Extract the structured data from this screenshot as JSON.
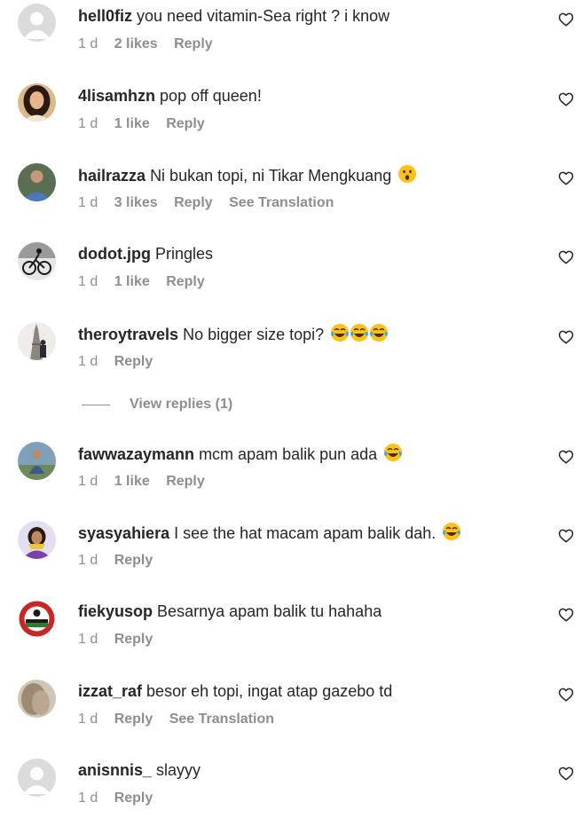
{
  "comments": [
    {
      "username": "hell0fiz",
      "text": "you need vitamin-Sea right ? i know",
      "time": "1 d",
      "likes": "2 likes",
      "reply": "Reply",
      "avatar": "default-avatar-icon"
    },
    {
      "username": "4lisamhzn",
      "text": "pop off queen!",
      "time": "1 d",
      "likes": "1 like",
      "reply": "Reply",
      "avatar": "woman-portrait"
    },
    {
      "username": "hailrazza",
      "text": "Ni bukan topi, ni Tikar Mengkuang",
      "emoji": "surprised-face-emoji",
      "time": "1 d",
      "likes": "3 likes",
      "reply": "Reply",
      "translation": "See Translation",
      "avatar": "man-blue-shirt"
    },
    {
      "username": "dodot.jpg",
      "text": "Pringles",
      "time": "1 d",
      "likes": "1 like",
      "reply": "Reply",
      "avatar": "cyclist-bw"
    },
    {
      "username": "theroytravels",
      "text": "No bigger size topi?",
      "emoji": "tears-of-joy-emoji-x3",
      "time": "1 d",
      "reply": "Reply",
      "avatar": "eiffel-tower"
    },
    {
      "username": "fawwazaymann",
      "text": "mcm apam balik pun ada",
      "emoji": "tears-of-joy-emoji",
      "time": "1 d",
      "likes": "1 like",
      "reply": "Reply",
      "avatar": "man-outdoors"
    },
    {
      "username": "syasyahiera",
      "text": "I see the hat macam apam balik dah.",
      "emoji": "tears-of-joy-emoji",
      "time": "1 d",
      "reply": "Reply",
      "avatar": "woman-purple"
    },
    {
      "username": "fiekyusop",
      "text": "Besarnya apam balik tu hahaha",
      "time": "1 d",
      "reply": "Reply",
      "avatar": "red-emblem"
    },
    {
      "username": "izzat_raf",
      "text": "besor eh topi, ingat atap gazebo td",
      "time": "1 d",
      "reply": "Reply",
      "translation": "See Translation",
      "avatar": "blurred-hair"
    },
    {
      "username": "anisnnis_",
      "text": "slayyy",
      "time": "1 d",
      "reply": "Reply",
      "avatar": "default-avatar-icon"
    }
  ],
  "view_replies": {
    "label": "View replies (1)"
  },
  "colors": {
    "text": "#262626",
    "muted": "#8e8e8e",
    "background": "#ffffff"
  },
  "icons": {
    "like": "heart-outline-icon"
  }
}
